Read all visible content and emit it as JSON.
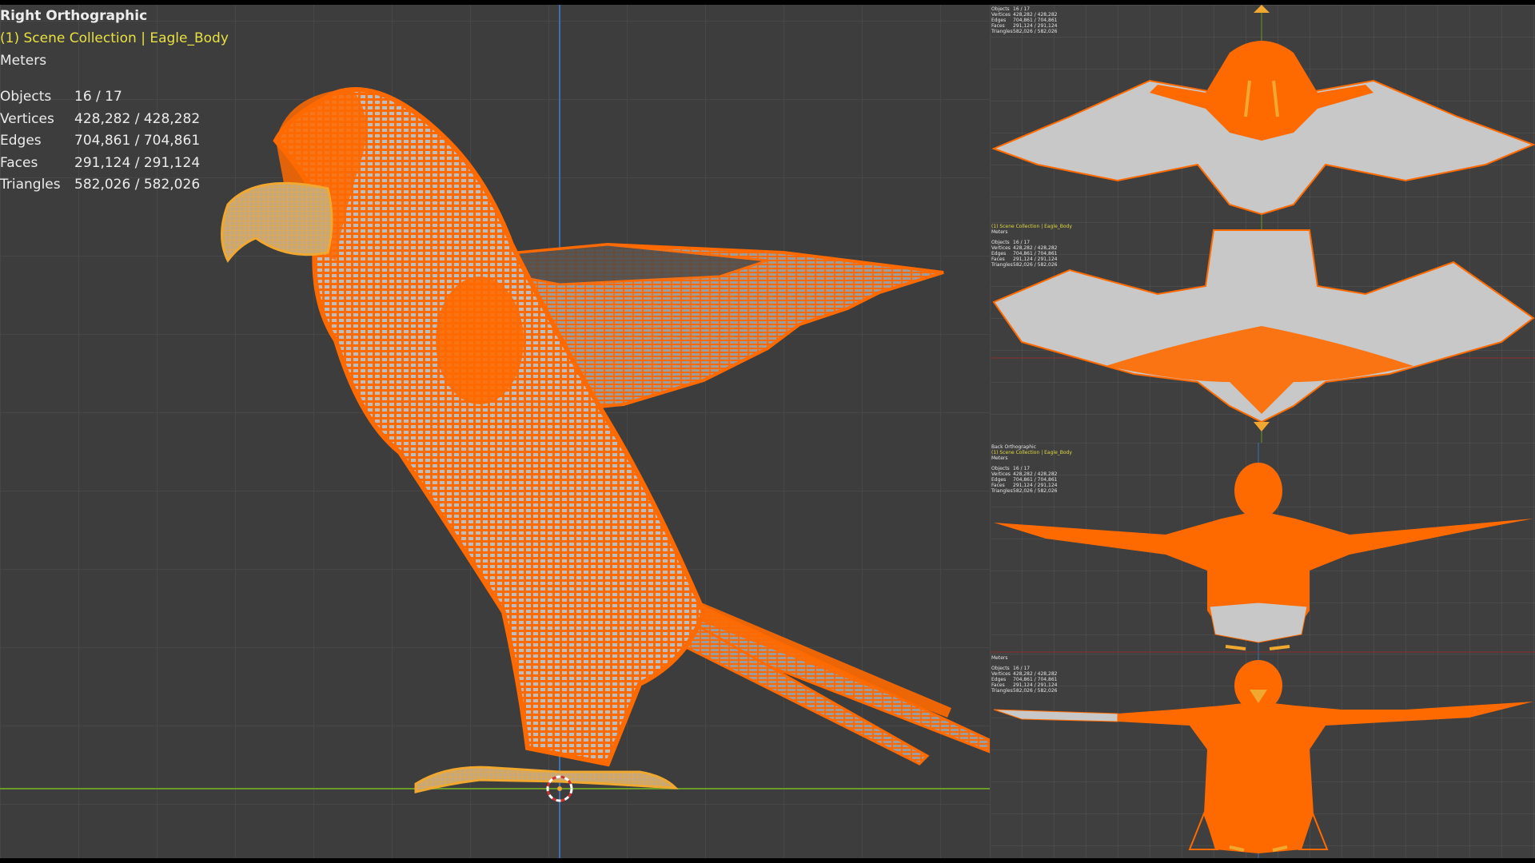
{
  "main_viewport": {
    "view_name": "Right Orthographic",
    "collection": "(1) Scene Collection | Eagle_Body",
    "units": "Meters",
    "stats": [
      {
        "label": "Objects",
        "value": "16 / 17"
      },
      {
        "label": "Vertices",
        "value": "428,282 / 428,282"
      },
      {
        "label": "Edges",
        "value": "704,861 / 704,861"
      },
      {
        "label": "Faces",
        "value": "291,124 / 291,124"
      },
      {
        "label": "Triangles",
        "value": "582,026 / 582,026"
      }
    ]
  },
  "panels": [
    {
      "view_name": "",
      "collection": "",
      "units": "",
      "stats": [
        {
          "label": "Objects",
          "value": "16 / 17"
        },
        {
          "label": "Vertices",
          "value": "428,282 / 428,282"
        },
        {
          "label": "Edges",
          "value": "704,861 / 704,861"
        },
        {
          "label": "Faces",
          "value": "291,124 / 291,124"
        },
        {
          "label": "Triangles",
          "value": "582,026 / 582,026"
        }
      ]
    },
    {
      "view_name": "",
      "collection": "(1) Scene Collection | Eagle_Body",
      "units": "Meters",
      "stats": [
        {
          "label": "Objects",
          "value": "16 / 17"
        },
        {
          "label": "Vertices",
          "value": "428,282 / 428,282"
        },
        {
          "label": "Edges",
          "value": "704,861 / 704,861"
        },
        {
          "label": "Faces",
          "value": "291,124 / 291,124"
        },
        {
          "label": "Triangles",
          "value": "582,026 / 582,026"
        }
      ]
    },
    {
      "view_name": "Back Orthographic",
      "collection": "(1) Scene Collection | Eagle_Body",
      "units": "Meters",
      "stats": [
        {
          "label": "Objects",
          "value": "16 / 17"
        },
        {
          "label": "Vertices",
          "value": "428,282 / 428,282"
        },
        {
          "label": "Edges",
          "value": "704,861 / 704,861"
        },
        {
          "label": "Faces",
          "value": "291,124 / 291,124"
        },
        {
          "label": "Triangles",
          "value": "582,026 / 582,026"
        }
      ]
    },
    {
      "view_name": "",
      "collection": "",
      "units": "Meters",
      "stats": [
        {
          "label": "Objects",
          "value": "16 / 17"
        },
        {
          "label": "Vertices",
          "value": "428,282 / 428,282"
        },
        {
          "label": "Edges",
          "value": "704,861 / 704,861"
        },
        {
          "label": "Faces",
          "value": "291,124 / 291,124"
        },
        {
          "label": "Triangles",
          "value": "582,026 / 582,026"
        }
      ]
    }
  ],
  "colors": {
    "selection_orange": "#ff6a00",
    "active_yellow": "#f0a830",
    "mesh_gray": "#c8c8c8",
    "axis_blue": "#3a6fb0",
    "axis_green": "#6a9a2a",
    "grid_bg": "#3d3d3d"
  }
}
